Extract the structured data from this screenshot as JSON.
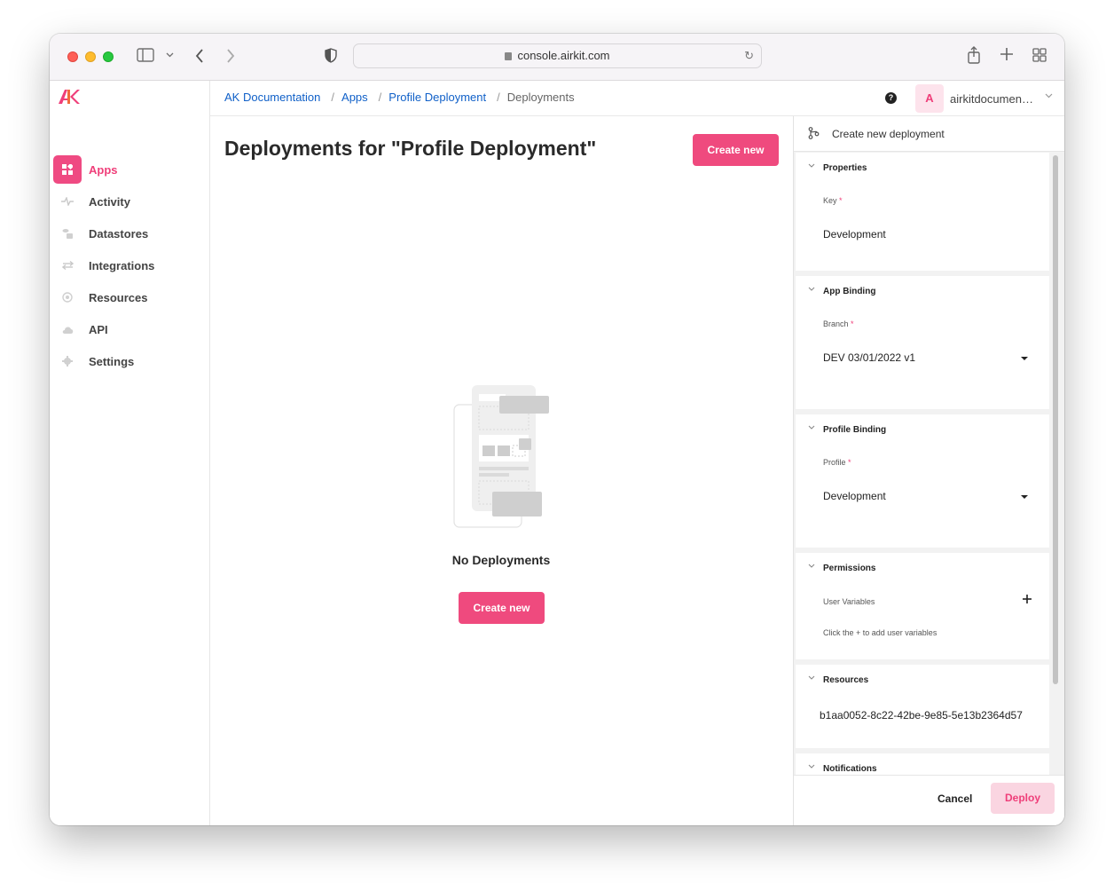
{
  "browser": {
    "url": "console.airkit.com"
  },
  "sidebar": {
    "items": [
      {
        "label": "Apps",
        "icon": "apps-icon",
        "active": true
      },
      {
        "label": "Activity",
        "icon": "activity-icon"
      },
      {
        "label": "Datastores",
        "icon": "datastores-icon"
      },
      {
        "label": "Integrations",
        "icon": "integrations-icon"
      },
      {
        "label": "Resources",
        "icon": "resources-icon"
      },
      {
        "label": "API",
        "icon": "api-icon"
      },
      {
        "label": "Settings",
        "icon": "settings-icon"
      }
    ]
  },
  "breadcrumb": [
    "AK Documentation",
    "Apps",
    "Profile Deployment",
    "Deployments"
  ],
  "account": {
    "avatar_letter": "A",
    "name": "airkitdocumentation"
  },
  "main": {
    "title": "Deployments for \"Profile Deployment\"",
    "create_label": "Create new",
    "empty_title": "No Deployments",
    "empty_create_label": "Create new"
  },
  "panel": {
    "title": "Create new deployment",
    "properties": {
      "title": "Properties",
      "key_label": "Key",
      "key_value": "Development"
    },
    "app_binding": {
      "title": "App Binding",
      "branch_label": "Branch",
      "branch_value": "DEV 03/01/2022 v1"
    },
    "profile_binding": {
      "title": "Profile Binding",
      "profile_label": "Profile",
      "profile_value": "Development"
    },
    "permissions": {
      "title": "Permissions",
      "user_vars_label": "User Variables",
      "hint": "Click the + to add user variables"
    },
    "resources": {
      "title": "Resources",
      "value": "b1aa0052-8c22-42be-9e85-5e13b2364d57"
    },
    "notifications": {
      "title": "Notifications"
    },
    "cancel_label": "Cancel",
    "deploy_label": "Deploy"
  },
  "colors": {
    "accent": "#ef4a7e",
    "link": "#1060c8"
  }
}
